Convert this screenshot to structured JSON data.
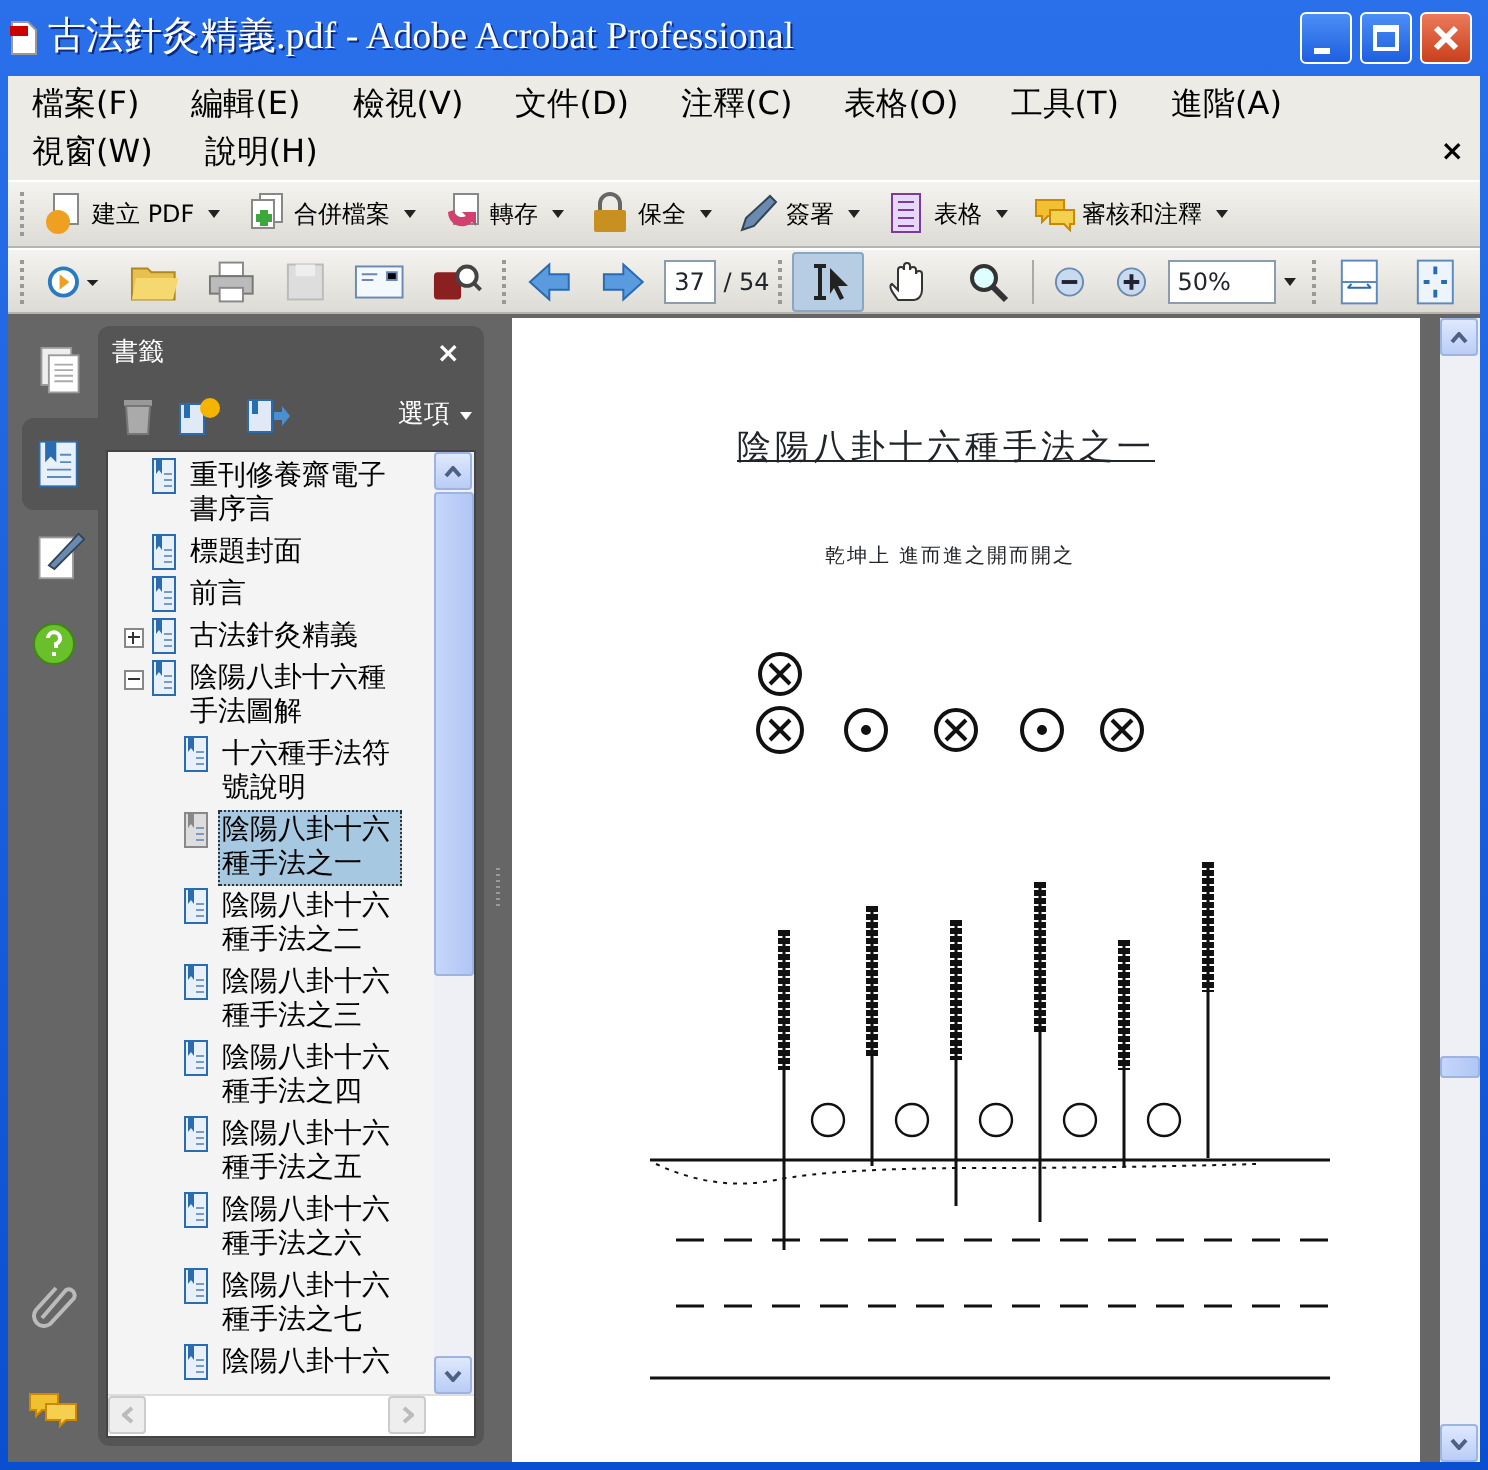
{
  "window": {
    "title": "古法針灸精義.pdf - Adobe Acrobat Professional"
  },
  "menu": {
    "items": [
      "檔案(F)",
      "編輯(E)",
      "檢視(V)",
      "文件(D)",
      "注釋(C)",
      "表格(O)",
      "工具(T)",
      "進階(A)",
      "視窗(W)",
      "說明(H)"
    ],
    "close": "×"
  },
  "task_toolbar": [
    {
      "label": "建立 PDF"
    },
    {
      "label": "合併檔案"
    },
    {
      "label": "轉存"
    },
    {
      "label": "保全"
    },
    {
      "label": "簽署"
    },
    {
      "label": "表格"
    },
    {
      "label": "審核和注釋"
    }
  ],
  "nav": {
    "page": "37",
    "page_count": "/ 54",
    "zoom": "50%"
  },
  "tools": [
    {
      "selected": true
    },
    {
      "selected": false
    },
    {
      "selected": false
    }
  ],
  "side_tabs": [
    {
      "selected": false
    },
    {
      "selected": true
    },
    {
      "selected": false
    }
  ],
  "bookmarks": {
    "title": "書籤",
    "close": "×",
    "options": "選項",
    "items": [
      {
        "label": "重刊修養齋電子書序言",
        "selected": false
      },
      {
        "label": "標題封面",
        "selected": false
      },
      {
        "label": "前言",
        "selected": false
      },
      {
        "label": "古法針灸精義",
        "selected": false,
        "expanded": false
      },
      {
        "label": "陰陽八卦十六種手法圖解",
        "selected": false,
        "expanded": true,
        "children": [
          {
            "label": "十六種手法符號說明",
            "selected": false
          },
          {
            "label": "陰陽八卦十六種手法之一",
            "selected": true
          },
          {
            "label": "陰陽八卦十六種手法之二",
            "selected": false
          },
          {
            "label": "陰陽八卦十六種手法之三",
            "selected": false
          },
          {
            "label": "陰陽八卦十六種手法之四",
            "selected": false
          },
          {
            "label": "陰陽八卦十六種手法之五",
            "selected": false
          },
          {
            "label": "陰陽八卦十六種手法之六",
            "selected": false
          },
          {
            "label": "陰陽八卦十六種手法之七",
            "selected": false
          },
          {
            "label": "陰陽八卦十六",
            "selected": false
          }
        ]
      }
    ]
  },
  "document": {
    "title": "陰陽八卦十六種手法之一",
    "subtitle": "乾坤上 進而進之開而開之"
  }
}
